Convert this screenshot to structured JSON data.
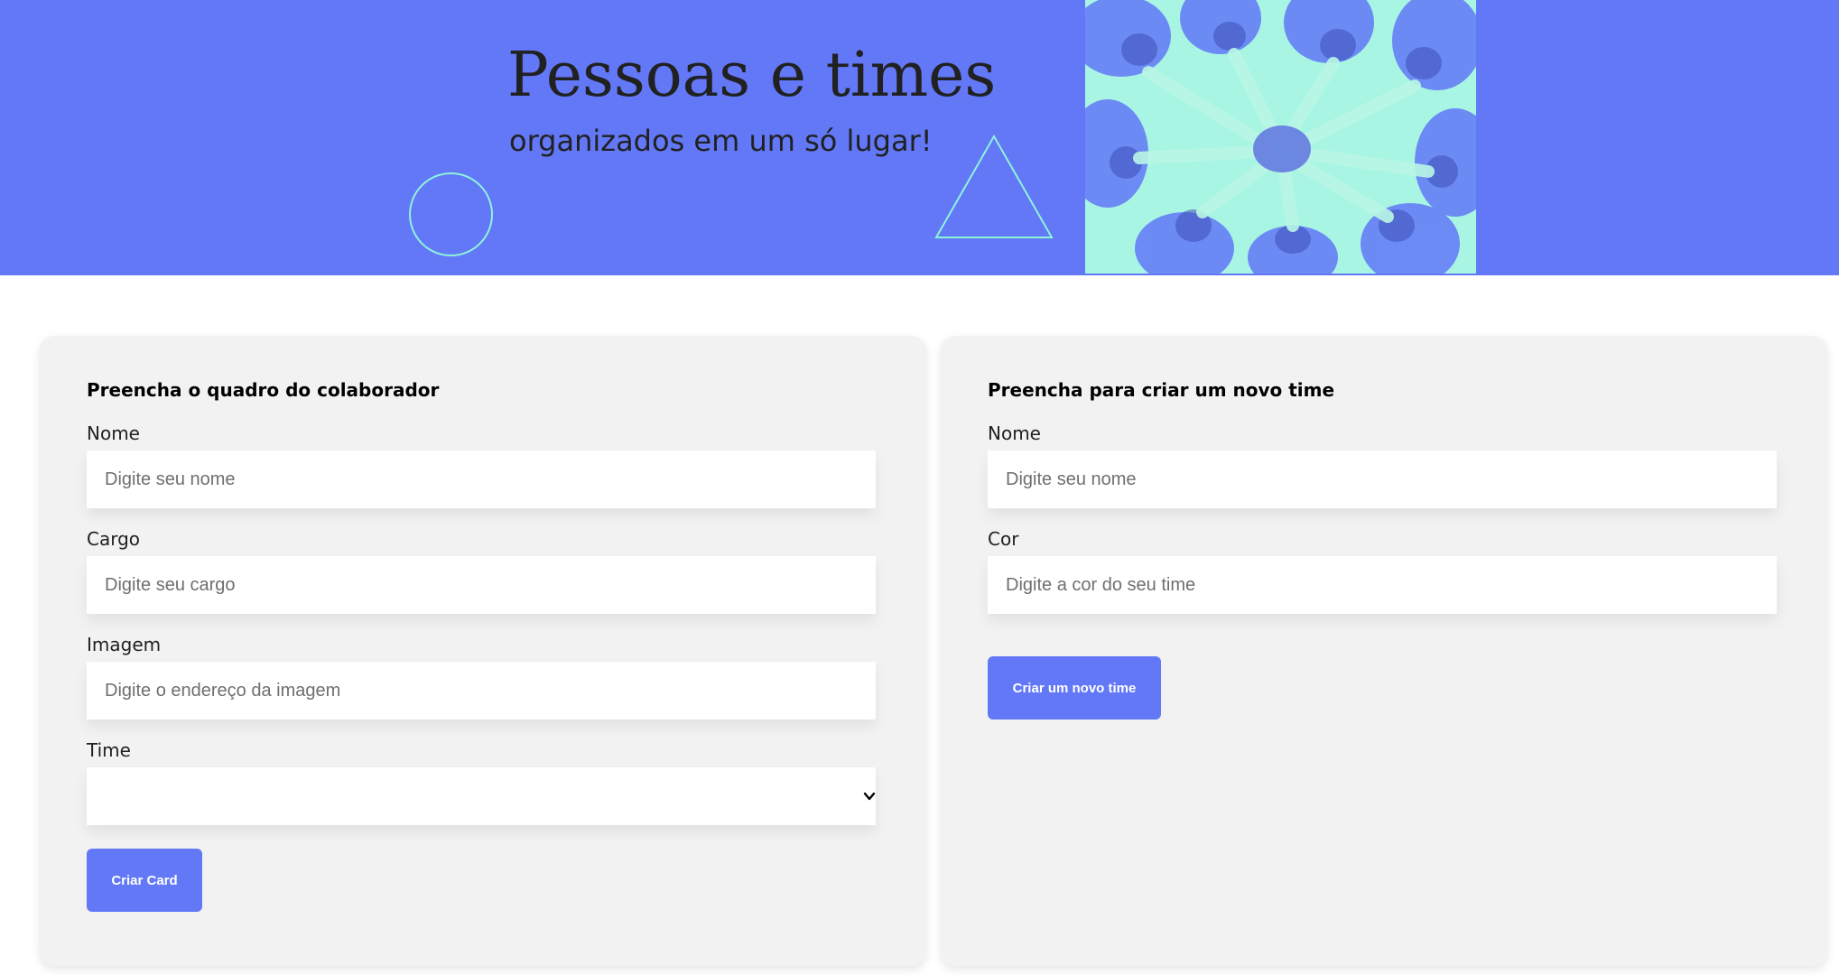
{
  "banner": {
    "title": "Pessoas e times",
    "subtitle": "organizados em um só lugar!",
    "background_color": "#6278f7",
    "accent_color": "#8ff3dc",
    "image_icon": "team-hands-together-photo"
  },
  "collaborator_form": {
    "heading": "Preencha o quadro do colaborador",
    "fields": [
      {
        "label": "Nome",
        "placeholder": "Digite seu nome",
        "value": ""
      },
      {
        "label": "Cargo",
        "placeholder": "Digite seu cargo",
        "value": ""
      },
      {
        "label": "Imagem",
        "placeholder": "Digite o endereço da imagem",
        "value": ""
      }
    ],
    "team_select": {
      "label": "Time",
      "selected": "",
      "icon": "chevron-down-icon"
    },
    "submit_label": "Criar Card"
  },
  "team_form": {
    "heading": "Preencha para criar um novo time",
    "fields": [
      {
        "label": "Nome",
        "placeholder": "Digite seu nome",
        "value": ""
      },
      {
        "label": "Cor",
        "placeholder": "Digite a cor do seu time",
        "value": ""
      }
    ],
    "submit_label": "Criar um novo time"
  }
}
